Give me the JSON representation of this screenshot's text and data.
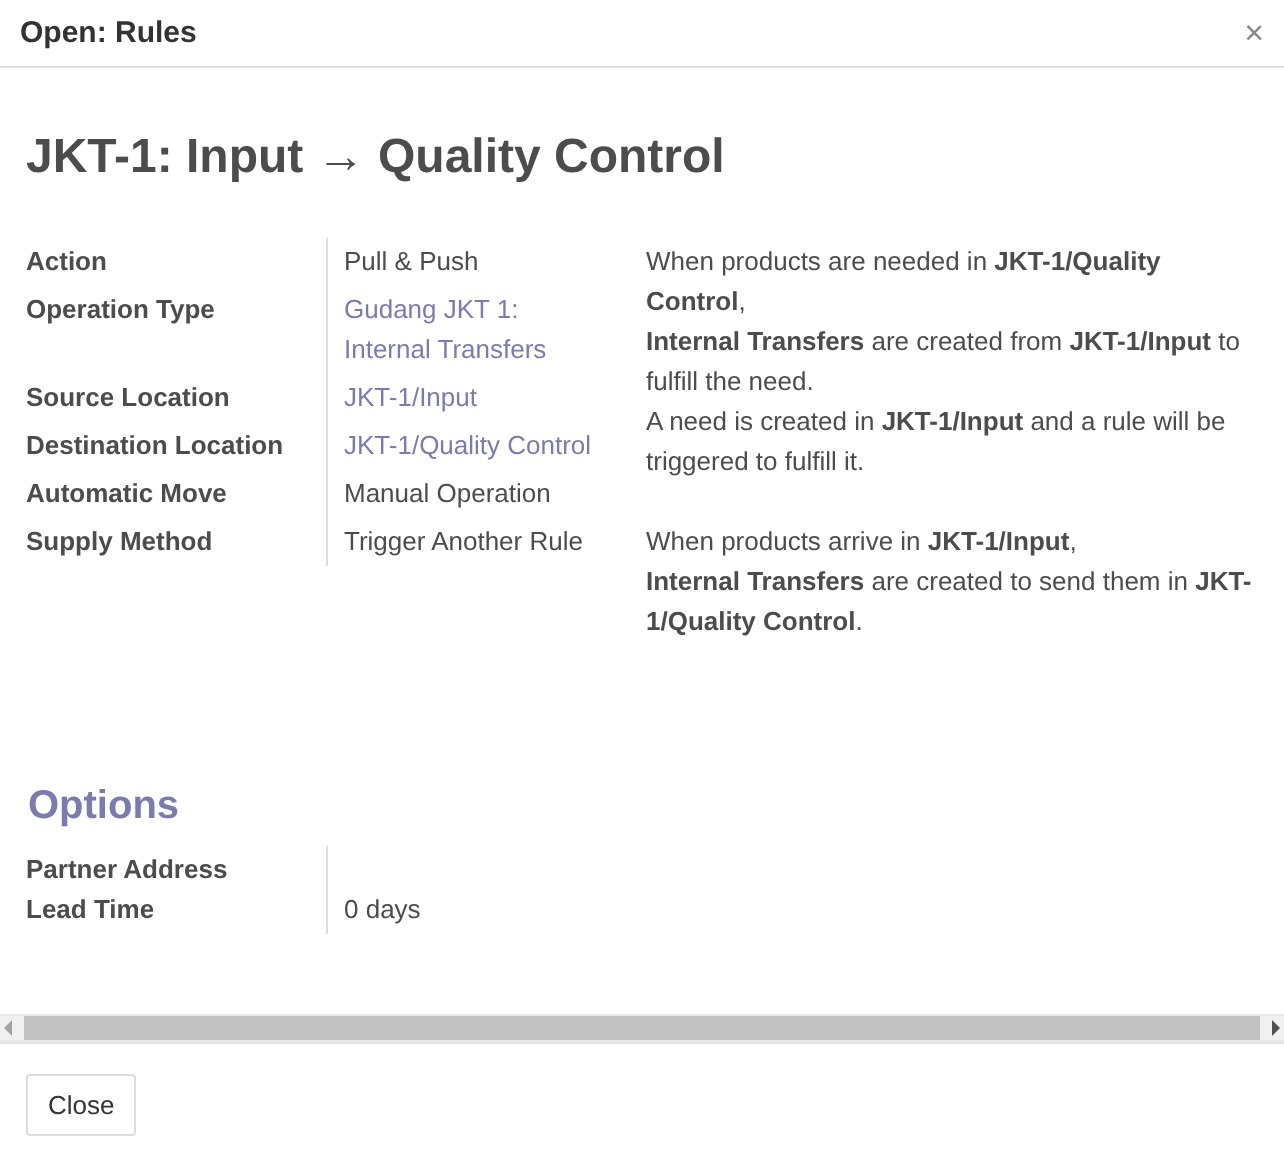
{
  "window": {
    "title": "Open: Rules",
    "close": "×"
  },
  "record_title": "JKT-1: Input → Quality Control",
  "fields": [
    {
      "label": "Action",
      "value": "Pull & Push",
      "kind": "text"
    },
    {
      "label": "Operation Type",
      "value": "Gudang JKT 1: Internal Transfers",
      "kind": "link"
    },
    {
      "label": "Source Location",
      "value": "JKT-1/Input",
      "kind": "link"
    },
    {
      "label": "Destination Location",
      "value": "JKT-1/Quality Control",
      "kind": "link"
    },
    {
      "label": "Automatic Move",
      "value": "Manual Operation",
      "kind": "text"
    },
    {
      "label": "Supply Method",
      "value": "Trigger Another Rule",
      "kind": "text"
    }
  ],
  "description": [
    {
      "lines": [
        "When products are needed in **JKT-1/Quality Control**,",
        "**Internal Transfers** are created from **JKT-1/Input** to fulfill the need.",
        "A need is created in **JKT-1/Input** and a rule will be triggered to fulfill it."
      ]
    },
    {
      "lines": [
        "When products arrive in **JKT-1/Input**,",
        "**Internal Transfers** are created to send them in **JKT-1/Quality Control**."
      ]
    }
  ],
  "options": {
    "heading": "Options",
    "fields": [
      {
        "label": "Partner Address",
        "kind": "text"
      },
      {
        "label": "Lead Time",
        "value": "0 days",
        "kind": "text"
      }
    ]
  },
  "buttons": [
    "Close"
  ]
}
